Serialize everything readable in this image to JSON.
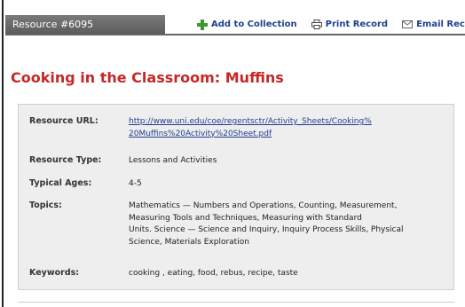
{
  "tab": {
    "label": "Resource #6095"
  },
  "actions": {
    "add_label": "Add to Collection",
    "print_label": "Print Record",
    "email_label": "Email Record"
  },
  "title": "Cooking in the Classroom: Muffins",
  "details": {
    "url_label": "Resource URL:",
    "url_line1": "http://www.uni.edu/coe/regentsctr/Activity_Sheets/Cooking%",
    "url_line2": "20Muffins%20Activity%20Sheet.pdf",
    "type_label": "Resource Type:",
    "type_value": "Lessons and Activities",
    "ages_label": "Typical Ages:",
    "ages_value": "4-5",
    "topics_label": "Topics:",
    "topics_line1": "Mathematics — Numbers and Operations, Counting, Measurement,",
    "topics_line2": "Measuring Tools and Techniques, Measuring with Standard",
    "topics_line3": "Units.  Science — Science and Inquiry, Inquiry Process Skills, Physical",
    "topics_line4": "Science, Materials Exploration",
    "keywords_label": "Keywords:",
    "keywords_value": "cooking , eating, food, rebus, recipe, taste"
  },
  "colors": {
    "title": "#c62828",
    "link": "#1f3f8f",
    "tab": "#6b6b6b",
    "panel": "#eeeeee",
    "add_icon": "#3a9b2c"
  },
  "icons": [
    "plus-icon",
    "printer-icon",
    "email-icon"
  ]
}
